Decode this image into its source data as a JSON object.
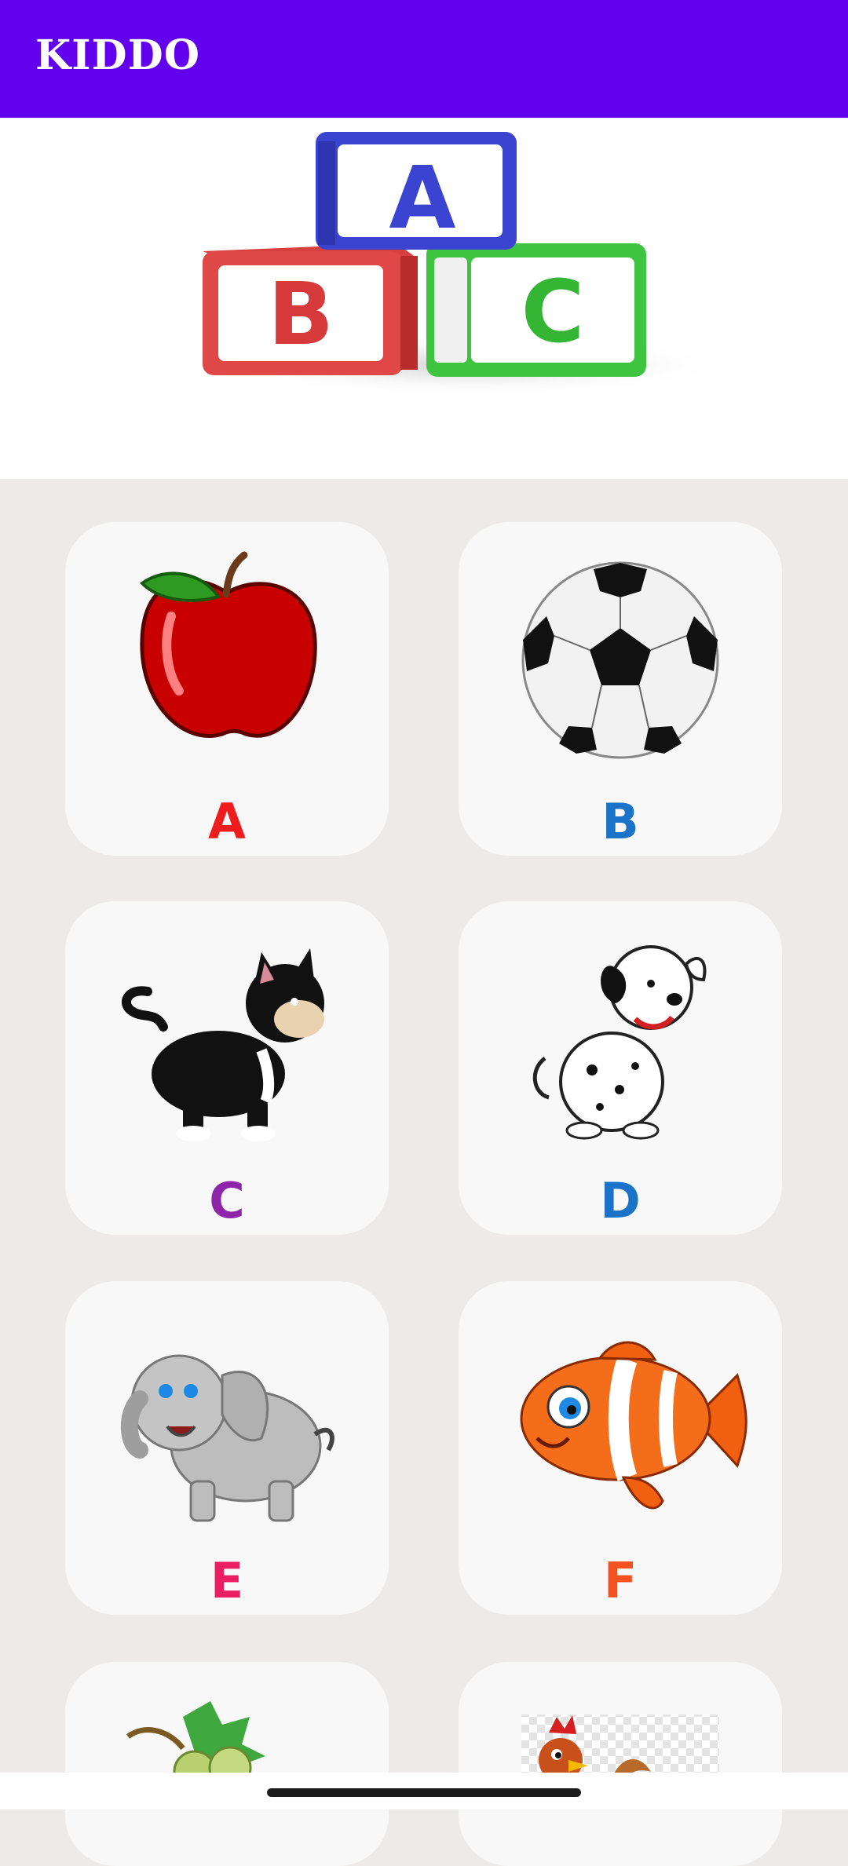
{
  "app_bar": {
    "title": "KIDDO",
    "color": "#6200ee"
  },
  "banner": {
    "blocks": [
      "A",
      "B",
      "C"
    ]
  },
  "cards": [
    {
      "letter": "A",
      "picture": "apple",
      "color": "#ee1c1c"
    },
    {
      "letter": "B",
      "picture": "soccer-ball",
      "color": "#1a73c9"
    },
    {
      "letter": "C",
      "picture": "cat",
      "color": "#8e24aa"
    },
    {
      "letter": "D",
      "picture": "dog",
      "color": "#1a73c9"
    },
    {
      "letter": "E",
      "picture": "elephant",
      "color": "#e91e63"
    },
    {
      "letter": "F",
      "picture": "fish",
      "color": "#f4511e"
    },
    {
      "letter": "",
      "picture": "grapes",
      "color": ""
    },
    {
      "letter": "",
      "picture": "hen",
      "color": ""
    }
  ]
}
